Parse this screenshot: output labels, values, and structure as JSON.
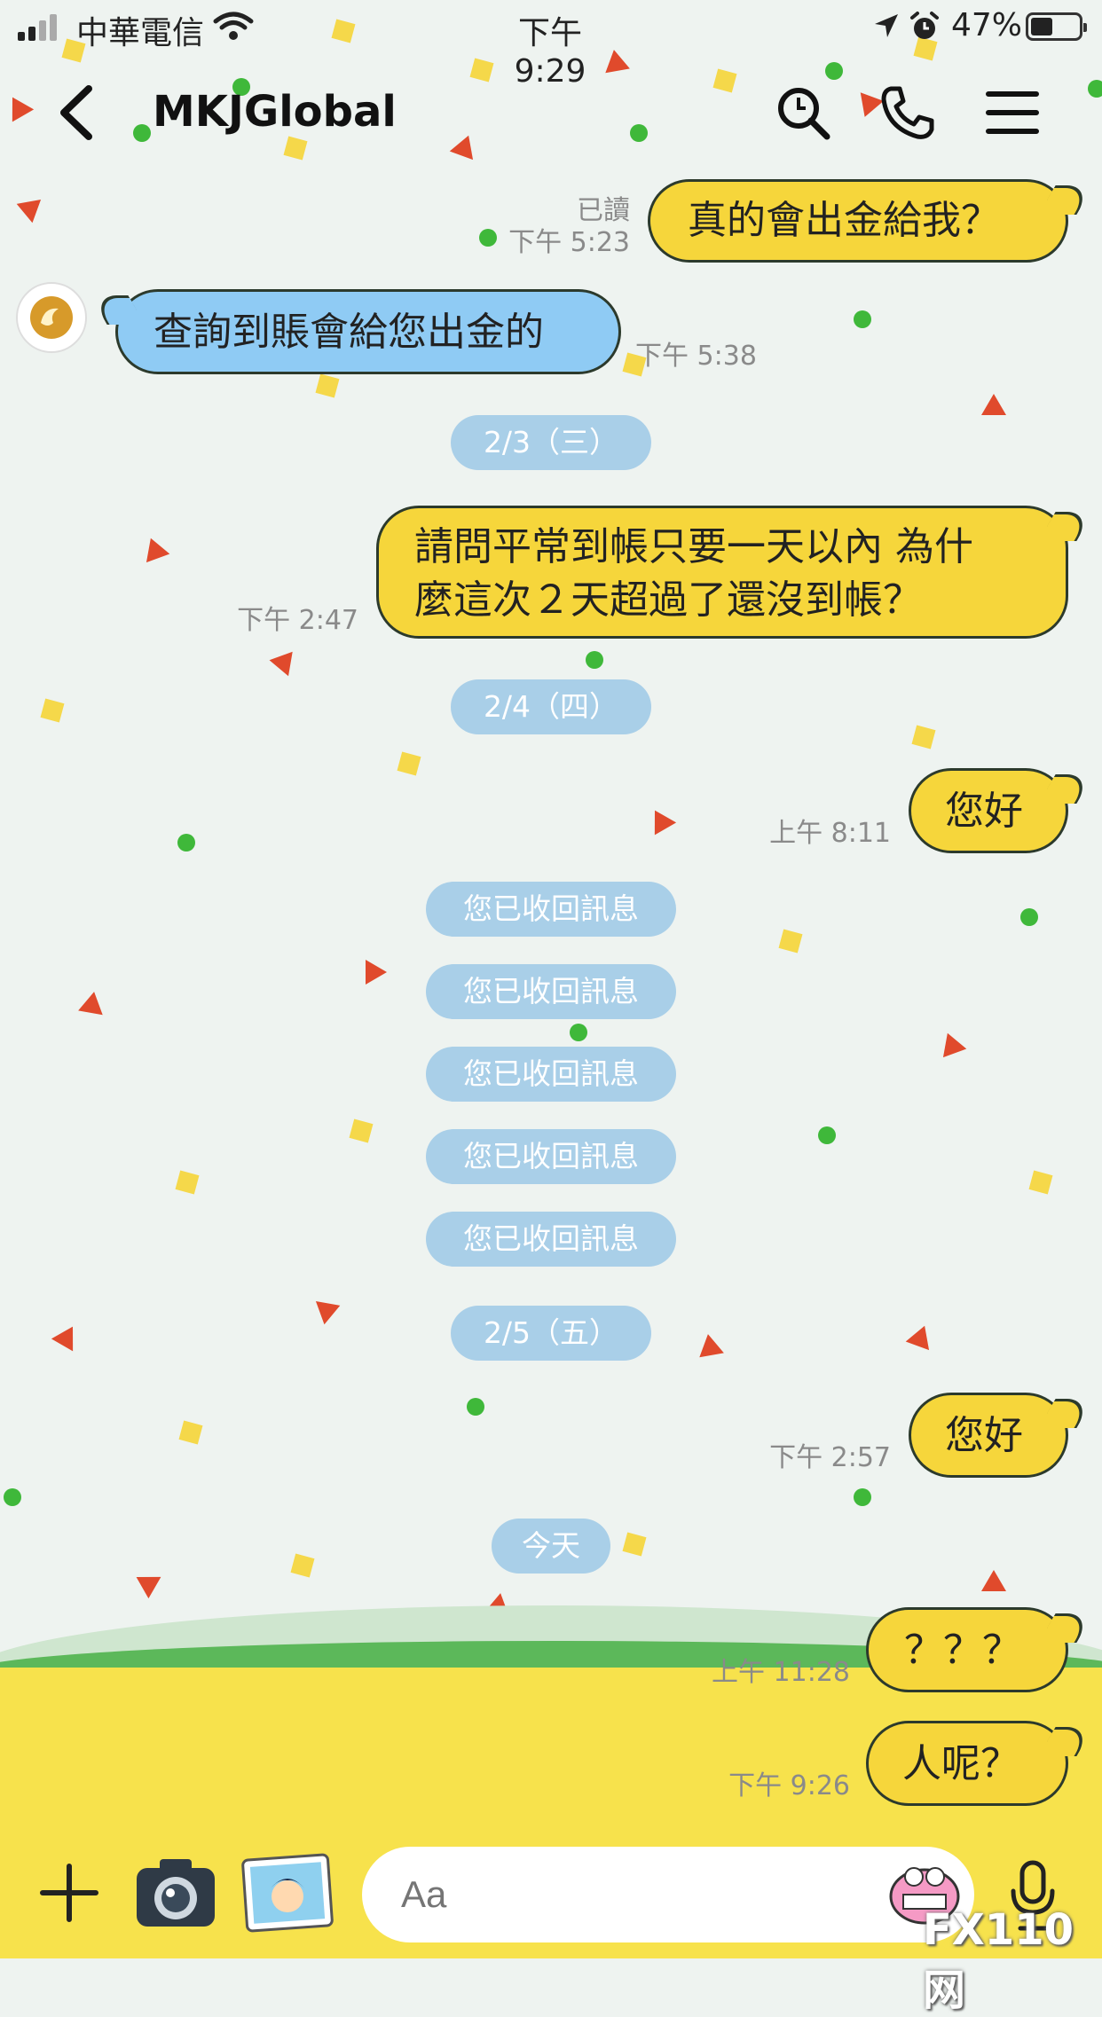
{
  "status_bar": {
    "carrier": "中華電信",
    "time": "下午 9:29",
    "battery": "47%",
    "battery_level": 0.47
  },
  "header": {
    "title": "MKJGlobal",
    "icons": [
      "back-icon",
      "search-icon",
      "phone-icon",
      "menu-icon"
    ]
  },
  "messages": [
    {
      "from": "me",
      "text": "真的會出金給我？",
      "read": "已讀",
      "time": "下午 5:23"
    },
    {
      "from": "them",
      "text": "查詢到賬會給您出金的",
      "time": "下午 5:38"
    },
    {
      "type": "date",
      "text": "2/3（三）"
    },
    {
      "from": "me",
      "lines": [
        "請問平常到帳只要一天以內 為什",
        "麼這次２天超過了還沒到帳？"
      ],
      "time": "下午 2:47"
    },
    {
      "type": "date",
      "text": "2/4（四）"
    },
    {
      "from": "me",
      "text": "您好",
      "time": "上午 8:11"
    },
    {
      "type": "system",
      "text": "您已收回訊息"
    },
    {
      "type": "system",
      "text": "您已收回訊息"
    },
    {
      "type": "system",
      "text": "您已收回訊息"
    },
    {
      "type": "system",
      "text": "您已收回訊息"
    },
    {
      "type": "system",
      "text": "您已收回訊息"
    },
    {
      "type": "date",
      "text": "2/5（五）"
    },
    {
      "from": "me",
      "text": "您好",
      "time": "下午 2:57"
    },
    {
      "type": "date",
      "text": "今天"
    },
    {
      "from": "me",
      "text": "？？？",
      "time": "上午 11:28"
    },
    {
      "from": "me",
      "text": "人呢？",
      "time": "下午 9:26"
    }
  ],
  "input_bar": {
    "placeholder": "Aa",
    "icons": [
      "plus-icon",
      "camera-icon",
      "photo-icon",
      "sticker-icon",
      "mic-icon"
    ]
  },
  "watermark": "FX110网",
  "colors": {
    "my_bubble": "#f6d63b",
    "their_bubble": "#8fcbf4",
    "date_pill": "#a9cfe8",
    "background": "#eef3f0"
  }
}
